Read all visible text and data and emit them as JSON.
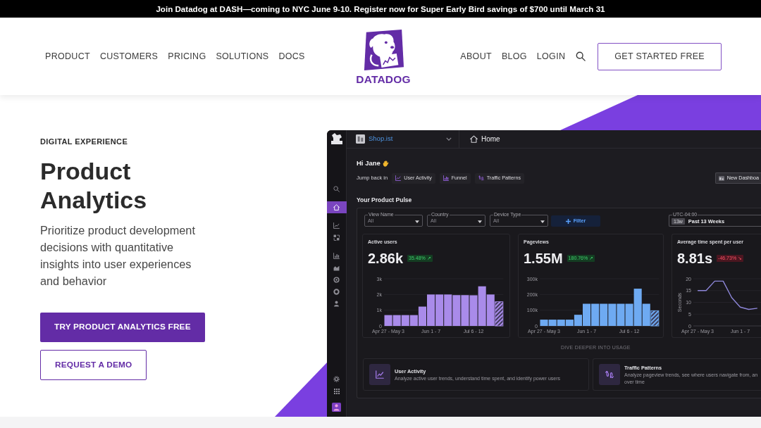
{
  "announcement": "Join Datadog at DASH—coming to NYC June 9-10. Register now for Super Early Bird savings of $700 until March 31",
  "header": {
    "nav_left": [
      "PRODUCT",
      "CUSTOMERS",
      "PRICING",
      "SOLUTIONS",
      "DOCS"
    ],
    "logo_text": "DATADOG",
    "nav_right": [
      "ABOUT",
      "BLOG",
      "LOGIN"
    ],
    "cta": "GET STARTED FREE"
  },
  "hero": {
    "eyebrow": "DIGITAL EXPERIENCE",
    "title": "Product Analytics",
    "description": "Prioritize product development decisions with quantitative insights into user experiences and behavior",
    "buttons": [
      {
        "label": "TRY PRODUCT ANALYTICS FREE",
        "kind": "primary"
      },
      {
        "label": "REQUEST A DEMO",
        "kind": "outline"
      }
    ]
  },
  "app": {
    "sidebar": {
      "items": [
        {
          "selected": false
        },
        {
          "selected": true
        },
        {
          "selected": false
        },
        {
          "selected": false
        },
        {
          "selected": false
        },
        {
          "selected": false
        },
        {
          "selected": false
        },
        {
          "selected": false
        },
        {
          "selected": false
        }
      ]
    },
    "workspace": "Shop.ist",
    "breadcrumb": "Home",
    "greeting": "Hi Jane",
    "jump_label": "Jump back in",
    "shortcuts": [
      "User Activity",
      "Funnel",
      "Traffic Patterns"
    ],
    "new_dashboard": "New Dashboa",
    "section_title": "Your Product Pulse",
    "filters": [
      {
        "label": "View Name",
        "value": "All"
      },
      {
        "label": "Country",
        "value": "All"
      },
      {
        "label": "Device Type",
        "value": "All"
      }
    ],
    "filter_button": "Filter",
    "time_range": {
      "timezone": "UTC-04:00",
      "badge": "13w",
      "label": "Past 13 Weeks"
    },
    "metrics": [
      {
        "title": "Active users",
        "value": "2.86k",
        "change": "35.48% ↗",
        "change_positive": true,
        "last_bar_partial": true,
        "chart_data": {
          "type": "bar",
          "categories": [
            "Apr 27 - May 3",
            null,
            null,
            null,
            null,
            "Jun 1 - 7",
            null,
            null,
            null,
            null,
            "Jul 6 - 12",
            null,
            null,
            null
          ],
          "series": [
            {
              "color": "#a98bea",
              "values": [
                690,
                690,
                690,
                690,
                1230,
                2000,
                2000,
                2000,
                1960,
                1960,
                1950,
                2520,
                2000,
                1540
              ]
            }
          ],
          "ylim": [
            0,
            3000
          ],
          "yticks": [
            {
              "value": 0,
              "label": "0"
            },
            {
              "value": 1000,
              "label": "1k"
            },
            {
              "value": 2000,
              "label": "2k"
            },
            {
              "value": 3000,
              "label": "3k"
            }
          ],
          "grid": true
        }
      },
      {
        "title": "Pageviews",
        "value": "1.55M",
        "change": "180.76% ↗",
        "change_positive": true,
        "last_bar_partial": true,
        "chart_data": {
          "type": "bar",
          "categories": [
            "Apr 27 - May 3",
            null,
            null,
            null,
            null,
            "Jun 1 - 7",
            null,
            null,
            null,
            null,
            "Jul 6 - 12",
            null,
            null,
            null
          ],
          "series": [
            {
              "color": "#6eaaf2",
              "values": [
                40000,
                40000,
                40000,
                40000,
                71000,
                141000,
                141000,
                141000,
                141000,
                141000,
                141000,
                237000,
                141000,
                97000
              ]
            }
          ],
          "ylim": [
            0,
            300000
          ],
          "yticks": [
            {
              "value": 0,
              "label": "0"
            },
            {
              "value": 100000,
              "label": "100k"
            },
            {
              "value": 200000,
              "label": "200k"
            },
            {
              "value": 300000,
              "label": "300k"
            }
          ],
          "grid": true
        }
      },
      {
        "title": "Average time spent per user",
        "value": "8.81s",
        "change": "-46.73% ↘",
        "change_positive": false,
        "chart_data": {
          "type": "line",
          "ylabel": "Seconds",
          "categories": [
            "Apr 27 - May 3",
            null,
            null,
            null,
            null,
            "Jun 1 - 7",
            null,
            null
          ],
          "series": [
            {
              "color": "#8d86d8",
              "values": [
                15,
                15,
                19,
                19,
                12,
                8,
                7,
                7.5
              ]
            }
          ],
          "ylim": [
            0,
            20
          ],
          "yticks": [
            0,
            5,
            10,
            15,
            20
          ],
          "grid": true
        }
      }
    ],
    "dive_deeper": "DIVE DEEPER INTO USAGE",
    "explore": [
      {
        "title": "User Activity",
        "description_lines": [
          "Analyze active user trends, understand time spent, and identify power users"
        ]
      },
      {
        "title": "Traffic Patterns",
        "description_lines": [
          "Analyze pageview trends, see where users navigate from, an",
          "over time"
        ]
      }
    ]
  }
}
